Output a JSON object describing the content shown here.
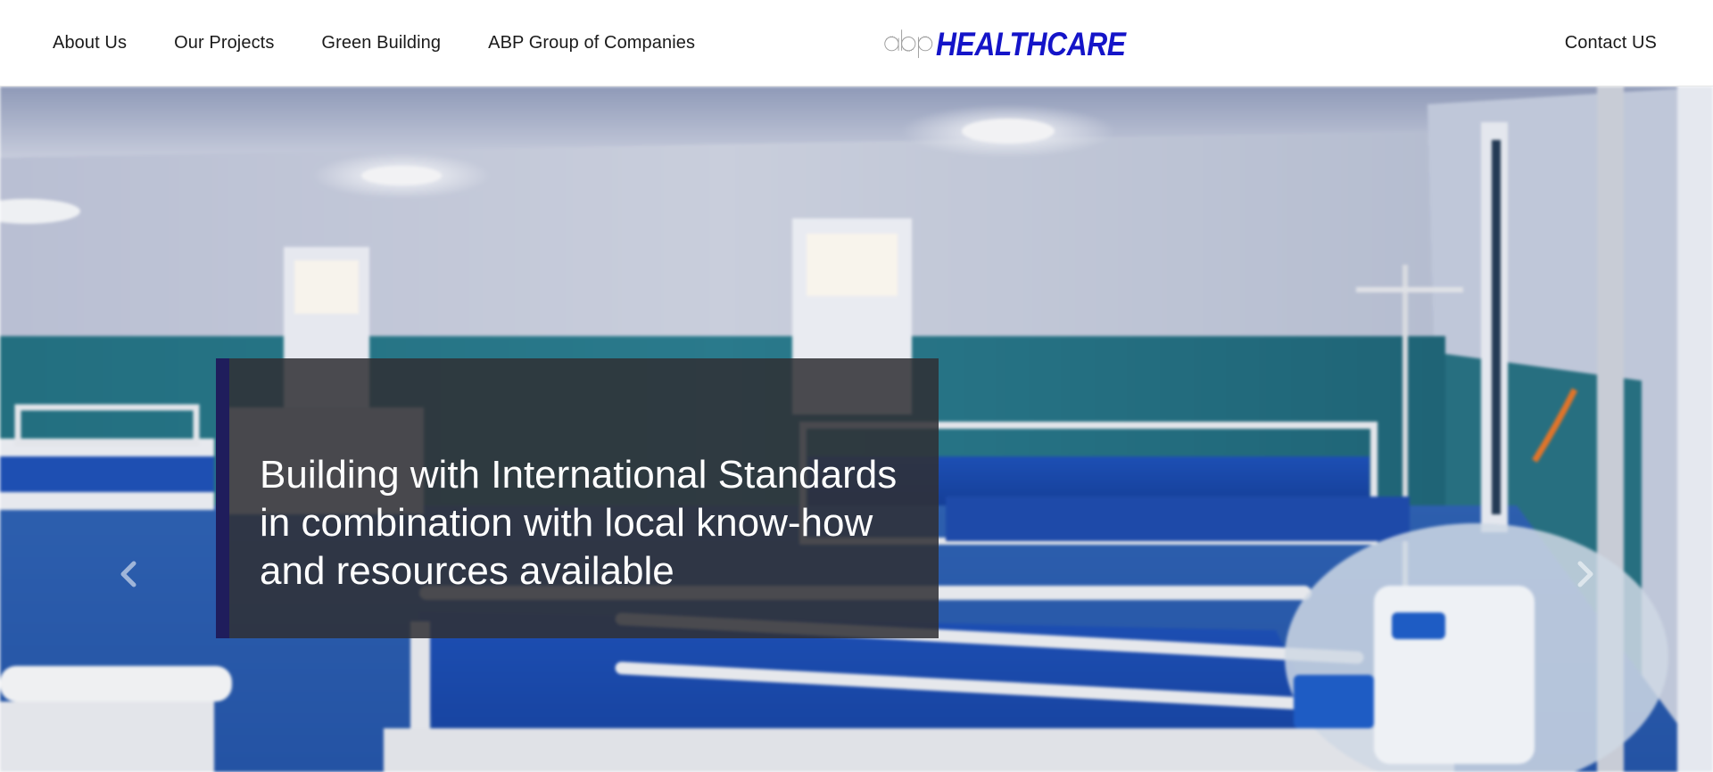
{
  "nav": {
    "left_links": [
      {
        "label": "About Us"
      },
      {
        "label": "Our Projects"
      },
      {
        "label": "Green Building"
      },
      {
        "label": "ABP Group of Companies"
      }
    ],
    "contact_label": "Contact US"
  },
  "logo": {
    "mark_text": "abp",
    "wordmark": "HEALTHCARE",
    "wordmark_color": "#1414c8",
    "mark_color": "#9a9a9a"
  },
  "hero": {
    "caption": "Building with International Standards in combination with local know-how and resources available",
    "prev_icon": "chevron-left-icon",
    "next_icon": "chevron-right-icon",
    "accent_color": "#1f1d5c"
  }
}
